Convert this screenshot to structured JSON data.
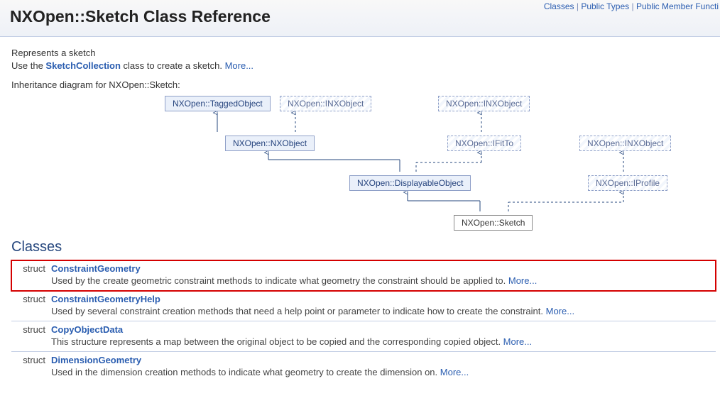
{
  "header": {
    "title": "NXOpen::Sketch Class Reference",
    "links": [
      "Classes",
      "Public Types",
      "Public Member Functi"
    ]
  },
  "description": {
    "line1": "Represents a sketch",
    "line2_pre": "Use the ",
    "line2_link": "SketchCollection",
    "line2_post": " class to create a sketch. ",
    "more": "More..."
  },
  "inheritance_label": "Inheritance diagram for NXOpen::Sketch:",
  "nodes": {
    "tagged": "NXOpen::TaggedObject",
    "inx1": "NXOpen::INXObject",
    "inx2": "NXOpen::INXObject",
    "nxobj": "NXOpen::NXObject",
    "ifitto": "NXOpen::IFitTo",
    "inx3": "NXOpen::INXObject",
    "disp": "NXOpen::DisplayableObject",
    "iprofile": "NXOpen::IProfile",
    "sketch": "NXOpen::Sketch"
  },
  "section": "Classes",
  "classes": [
    {
      "kind": "struct",
      "name": "ConstraintGeometry",
      "desc": "Used by the create geometric constraint methods to indicate what geometry the constraint should be applied to. ",
      "more": "More...",
      "highlight": true
    },
    {
      "kind": "struct",
      "name": "ConstraintGeometryHelp",
      "desc": "Used by several constraint creation methods that need a help point or parameter to indicate how to create the constraint. ",
      "more": "More..."
    },
    {
      "kind": "struct",
      "name": "CopyObjectData",
      "desc": "This structure represents a map between the original object to be copied and the corresponding copied object. ",
      "more": "More..."
    },
    {
      "kind": "struct",
      "name": "DimensionGeometry",
      "desc": "Used in the dimension creation methods to indicate what geometry to create the dimension on. ",
      "more": "More..."
    }
  ]
}
